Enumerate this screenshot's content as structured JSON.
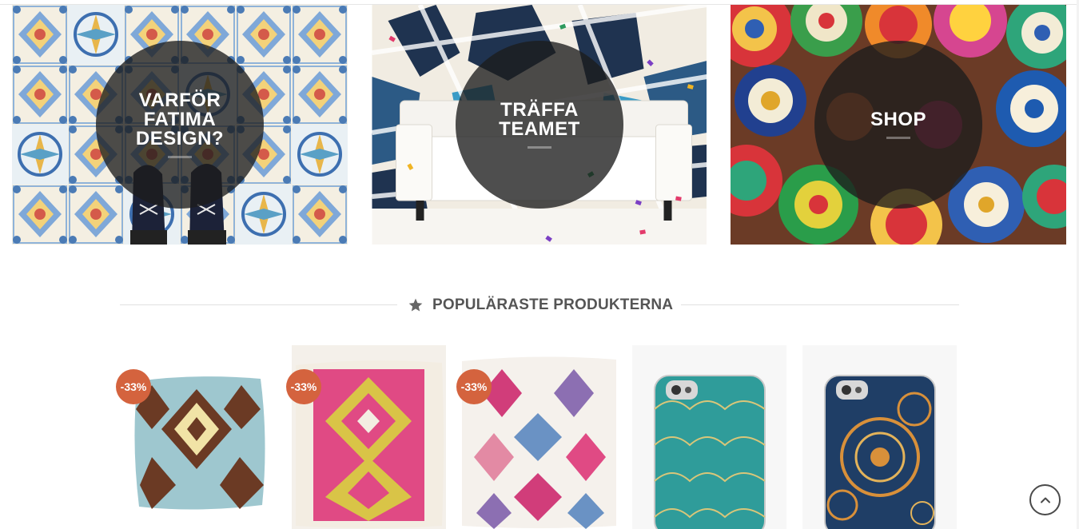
{
  "banners": [
    {
      "title": "VARFÖR\nFATIMA\nDESIGN?",
      "image": "moroccan-tiles-with-shoes"
    },
    {
      "title": "TRÄFFA\nTEAMET",
      "image": "white-sofa-with-confetti"
    },
    {
      "title": "SHOP",
      "image": "moroccan-plates"
    }
  ],
  "section": {
    "heading": "POPULÄRASTE PRODUKTERNA",
    "icon": "star-icon"
  },
  "products": [
    {
      "badge": "-33%",
      "image": "kilim-cushion-blue"
    },
    {
      "badge": "-33%",
      "image": "kilim-cushion-pink"
    },
    {
      "badge": "-33%",
      "image": "kilim-cushion-white"
    },
    {
      "badge": "",
      "image": "iphone-case-teal-moroccan"
    },
    {
      "badge": "",
      "image": "iphone-case-blue-mandala"
    }
  ],
  "scroll_top": {
    "icon": "chevron-up-icon"
  },
  "colors": {
    "badge": "#d4633e",
    "overlay": "#1c1c1c",
    "heading": "#555555"
  }
}
